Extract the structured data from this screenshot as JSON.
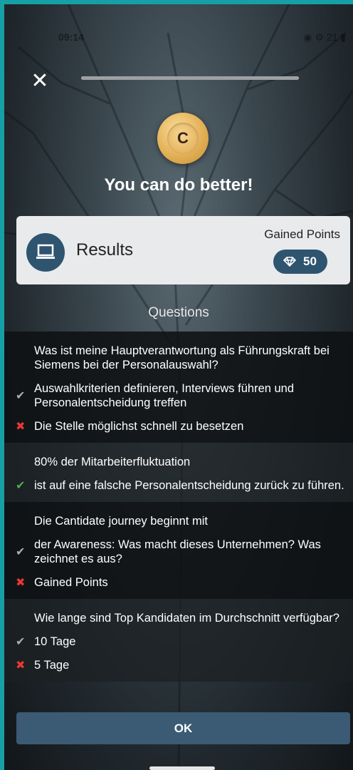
{
  "status": {
    "time": "09:14",
    "right": "◉ ⚙ 21 ▮"
  },
  "header": {
    "progress": 1.0
  },
  "grade": {
    "letter": "C",
    "headline": "You can do better!"
  },
  "results": {
    "title": "Results",
    "gained_label": "Gained Points",
    "points": "50"
  },
  "questions_heading": "Questions",
  "questions": [
    {
      "text": "Was ist meine Hauptverantwortung als Führungskraft bei Siemens bei der Personalauswahl?",
      "answers": [
        {
          "mark": "✔",
          "type": "ok",
          "text": "Auswahlkriterien definieren, Interviews führen und Personalentscheidung treffen"
        },
        {
          "mark": "✖",
          "type": "no",
          "text": "Die Stelle möglichst schnell zu besetzen"
        }
      ]
    },
    {
      "text": "80% der Mitarbeiterfluktuation",
      "answers": [
        {
          "mark": "✔",
          "type": "ok green",
          "text": "ist auf eine falsche Personalentscheidung zurück zu führen."
        }
      ]
    },
    {
      "text": "Die Cantidate journey beginnt mit",
      "answers": [
        {
          "mark": "✔",
          "type": "ok",
          "text": "der Awareness: Was macht dieses Unternehmen? Was zeichnet es aus?"
        },
        {
          "mark": "✖",
          "type": "no",
          "text": "Gained Points"
        }
      ]
    },
    {
      "text": "Wie lange sind Top Kandidaten im Durchschnitt verfügbar?",
      "answers": [
        {
          "mark": "✔",
          "type": "ok",
          "text": "10 Tage"
        },
        {
          "mark": "✖",
          "type": "no",
          "text": "5 Tage"
        }
      ]
    }
  ],
  "ok_button": "OK",
  "colors": {
    "accent": "#2f5470",
    "button": "#3b5a74",
    "frame": "#16a0a6",
    "wrong": "#e53935",
    "right": "#4caf50"
  }
}
